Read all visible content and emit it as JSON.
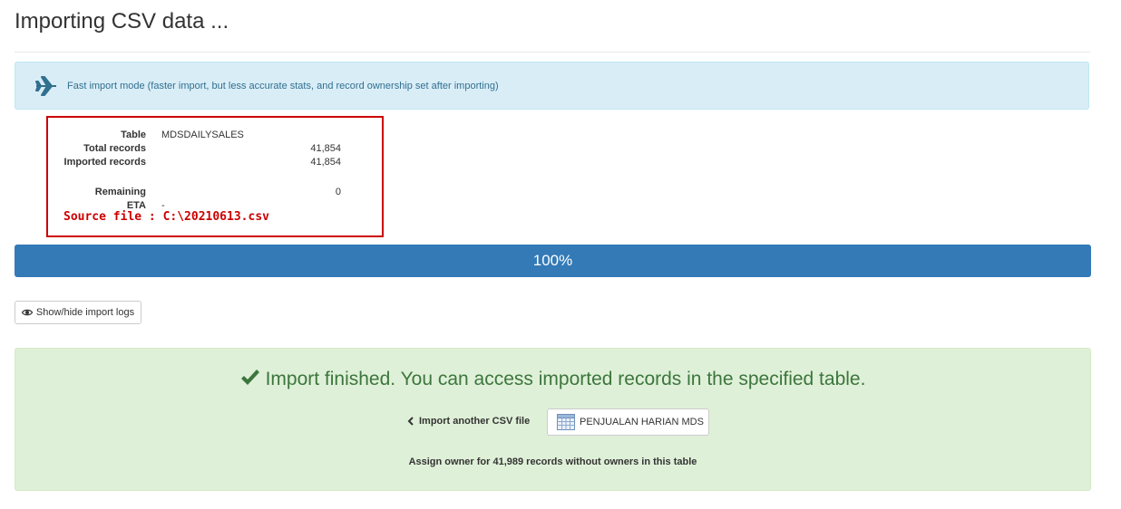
{
  "page": {
    "title": "Importing CSV data ..."
  },
  "info_alert": {
    "icon": "plane-icon",
    "text": "Fast import mode (faster import, but less accurate stats, and record ownership set after importing)"
  },
  "stats": {
    "table_label": "Table",
    "table_value": "MDSDAILYSALES",
    "total_label": "Total records",
    "total_value": "41,854",
    "imported_label": "Imported records",
    "imported_value": "41,854",
    "remaining_label": "Remaining",
    "remaining_value": "0",
    "eta_label": "ETA",
    "eta_value": "-",
    "source_note": "Source file : C:\\20210613.csv"
  },
  "progress": {
    "label": "100%",
    "value": 1.0
  },
  "logs_button": {
    "icon": "eye-icon",
    "label": "Show/hide import logs"
  },
  "success": {
    "icon": "check-icon",
    "message": "Import finished. You can access imported records in the specified table.",
    "import_another": "Import another CSV file",
    "table_button": "PENJUALAN HARIAN MDS",
    "assign_owner": "Assign owner for 41,989 records without owners in this table"
  },
  "colors": {
    "info_bg": "#d9edf7",
    "progress": "#337ab7",
    "success_bg": "#dff0d8",
    "success_text": "#3c763d",
    "annotation": "#cc0000"
  }
}
